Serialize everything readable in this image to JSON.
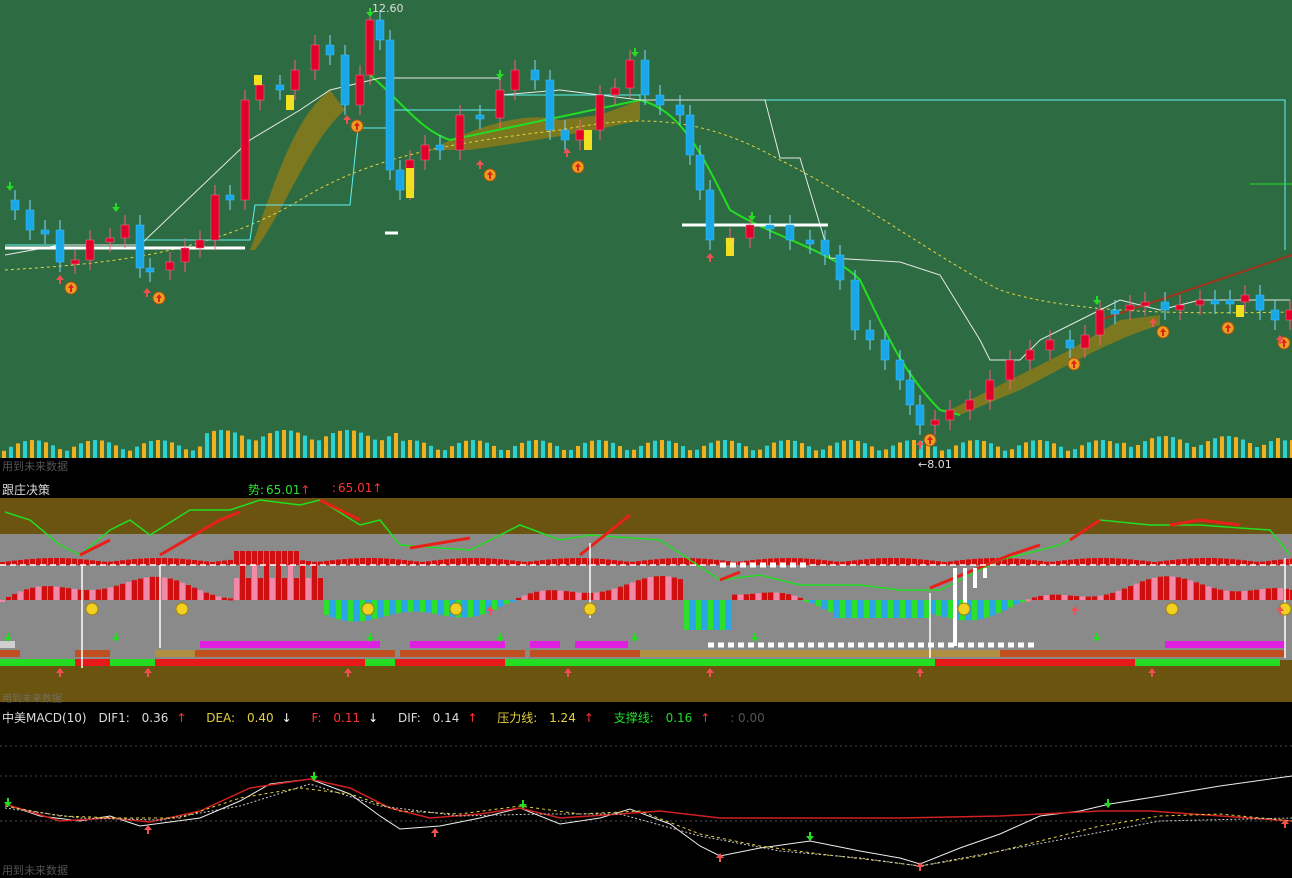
{
  "main": {
    "high_label": "12.60",
    "low_label": "8.01",
    "watermark": "用到未来数据"
  },
  "mid": {
    "title": "跟庄决策",
    "shi_label": "势:",
    "shi_value": "65.01",
    "second_value": "65.01",
    "watermark": "用到未来数据"
  },
  "macd": {
    "title": "中美MACD(10)",
    "dif1_label": "DIF1:",
    "dif1_value": "0.36",
    "dea_label": "DEA:",
    "dea_value": "0.40",
    "f_label": "F:",
    "f_value": "0.11",
    "dif_label": "DIF:",
    "dif_value": "0.14",
    "pressure_label": "压力线:",
    "pressure_value": "1.24",
    "support_label": "支撑线:",
    "support_value": "0.16",
    "extra_value": ": 0.00",
    "watermark": "用到未来数据"
  },
  "colors": {
    "chart_bg": "#2d6b42",
    "mid_bg": "#6a5410",
    "up_candle": "#e0002a",
    "down_candle": "#1aa7e6",
    "ma_green": "#22dd22",
    "ma_yellow": "#e6d23c",
    "band": "#8a7a1a",
    "line_cyan": "#5ff0f0",
    "line_white": "#ffffff"
  },
  "icons": [
    "up-arrow-icon",
    "down-arrow-icon",
    "buy-signal-coin-icon",
    "smiley-icon"
  ]
}
